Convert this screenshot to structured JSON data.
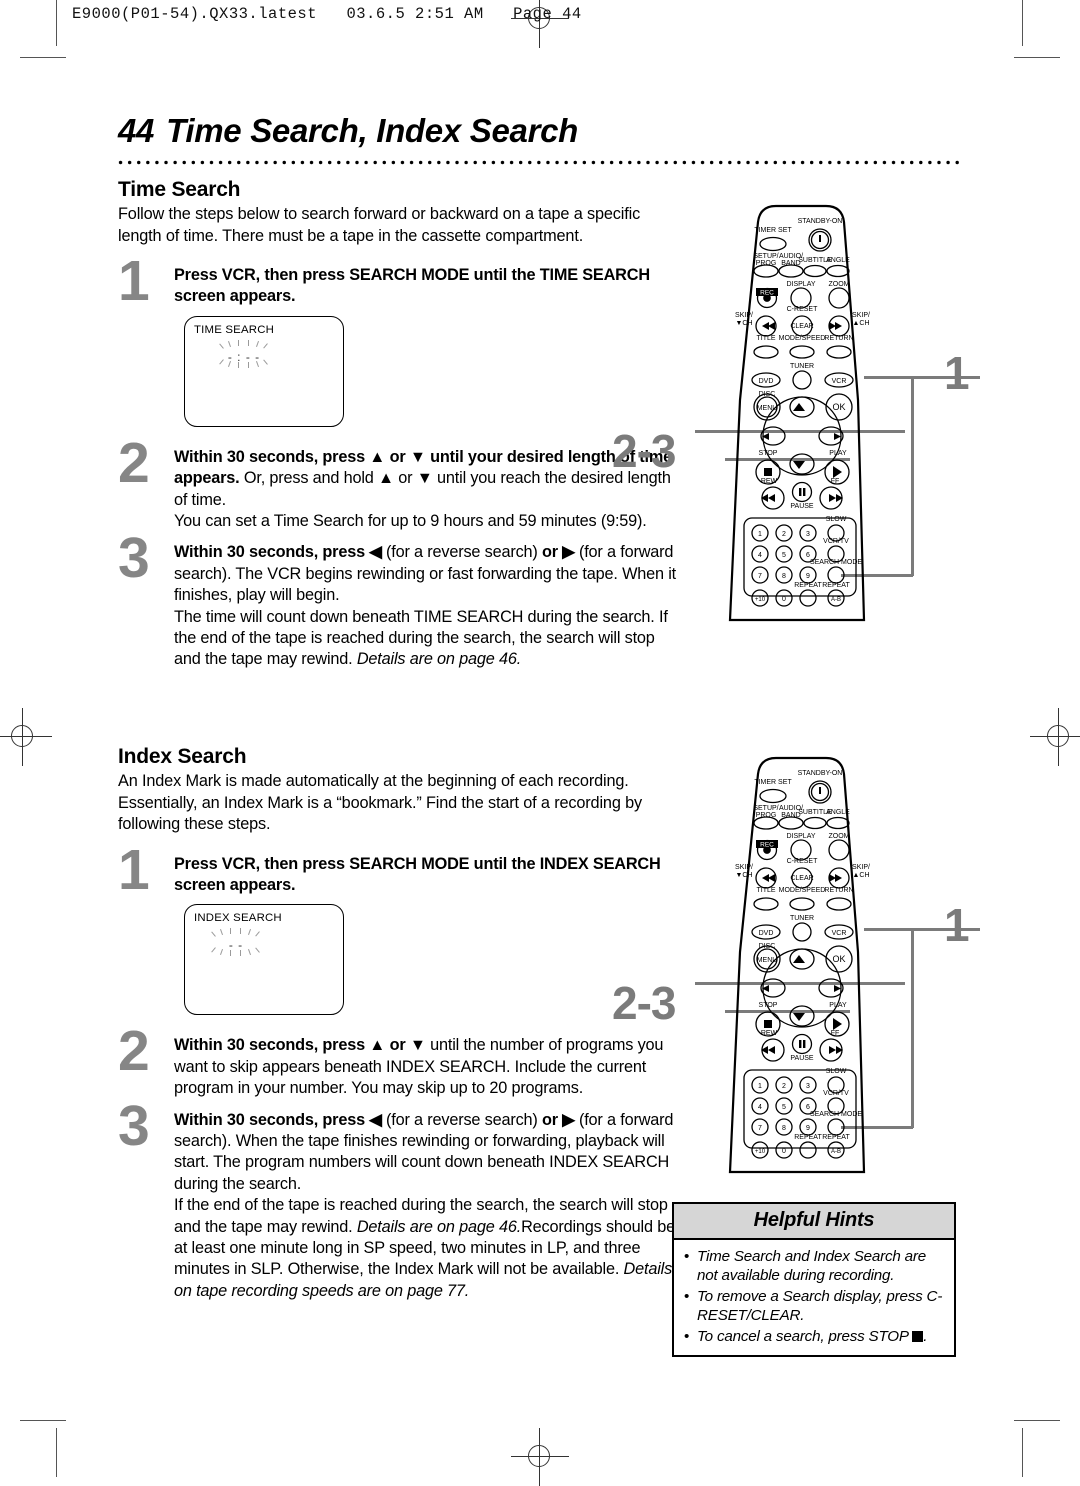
{
  "print_header": "E9000(P01-54).QX33.latest   03.6.5 2:51 AM   Page 44",
  "page_title": {
    "number": "44",
    "text": "Time Search, Index Search"
  },
  "time_search": {
    "heading": "Time Search",
    "intro": "Follow the steps below to search forward or backward on a tape a specific length of time. There must be a tape in the cassette compartment.",
    "steps": [
      {
        "num": "1",
        "bold": "Press VCR, then press SEARCH MODE until the TIME SEARCH screen appears.",
        "rest": ""
      },
      {
        "num": "2",
        "bold": "Within 30 seconds, press ▲ or ▼ until your desired length of time appears.",
        "rest": " Or, press and hold ▲ or ▼ until you reach the desired length of time.",
        "extra": "You can set a Time Search for up to 9 hours and 59 minutes (9:59)."
      },
      {
        "num": "3",
        "bold": "Within 30 seconds, press ◀",
        "mid": " (for a reverse search) ",
        "bold2": "or ▶",
        "rest": " (for a forward search). The VCR begins rewinding or fast forwarding the tape. When it finishes, play will begin.",
        "extra": "The time will count down beneath TIME SEARCH during the search. If the end of the tape is reached during the search, the search will stop and the tape may rewind. ",
        "italic": "Details are on page 46."
      }
    ],
    "osd": {
      "label": "TIME SEARCH",
      "value": "- : - -"
    }
  },
  "index_search": {
    "heading": "Index Search",
    "intro": "An Index Mark is made automatically at the beginning of each recording. Essentially, an Index Mark is a “bookmark.” Find the start of a recording by following these steps.",
    "steps": [
      {
        "num": "1",
        "bold": "Press VCR, then press SEARCH MODE until the INDEX SEARCH screen appears.",
        "rest": ""
      },
      {
        "num": "2",
        "bold": "Within 30 seconds, press ▲ or ▼",
        "rest": " until the number of programs you want to skip appears beneath INDEX SEARCH. Include the current program in your number. You may skip up to 20 programs."
      },
      {
        "num": "3",
        "bold": "Within 30 seconds, press ◀",
        "mid": " (for a reverse search) ",
        "bold2": "or ▶",
        "rest": " (for a forward search). When the tape finishes rewinding or forwarding, playback will start. The program numbers will count down beneath INDEX SEARCH during the search.",
        "extra": "If the end of the tape is reached during the search, the search will stop and the tape may rewind. ",
        "italic": "Details are on page 46.",
        "extra2": "Recordings should be at least one minute long in SP speed, two minutes in LP, and three minutes in SLP. Otherwise, the Index Mark will not be available. ",
        "italic2": "Details on tape recording speeds are on page 77."
      }
    ],
    "osd": {
      "label": "INDEX SEARCH",
      "value": "- -"
    }
  },
  "remote": {
    "callouts": {
      "top": "1",
      "bottom": "2-3"
    },
    "buttons": {
      "timer_set": "TIMER SET",
      "standby_on": "STANDBY-ON",
      "setup_prog": "SETUP/\nPROG",
      "audio_band": "AUDIO/\nBAND",
      "subtitle": "SUBTITLE",
      "angle": "ANGLE",
      "rec": "REC",
      "display": "DISPLAY",
      "zoom": "ZOOM",
      "skip_down": "SKIP/\n▼CH",
      "c_reset": "C-RESET",
      "clear": "CLEAR",
      "skip_up": "SKIP/\n▲CH",
      "title": "TITLE",
      "mode_speed": "MODE/SPEED",
      "return": "RETURN",
      "dvd": "DVD",
      "tuner": "TUNER",
      "vcr": "VCR",
      "disc": "DISC",
      "menu": "MENU",
      "ok": "OK",
      "stop": "STOP",
      "play": "PLAY",
      "rew": "REW",
      "pause": "PAUSE",
      "ff": "FF",
      "slow": "SLOW",
      "vcr_tv": "VCR/TV",
      "search_mode": "SEARCH MODE",
      "repeat": "REPEAT",
      "repeat_ab": "REPEAT",
      "ab": "A-B"
    },
    "keypad": [
      "1",
      "2",
      "3",
      "4",
      "5",
      "6",
      "7",
      "8",
      "9",
      "+10",
      "0"
    ]
  },
  "hints": {
    "title": "Helpful Hints",
    "items": [
      "Time Search and Index Search are not available during recording.",
      "To remove a Search display, press C-RESET/CLEAR.",
      "To cancel a search, press STOP"
    ]
  }
}
